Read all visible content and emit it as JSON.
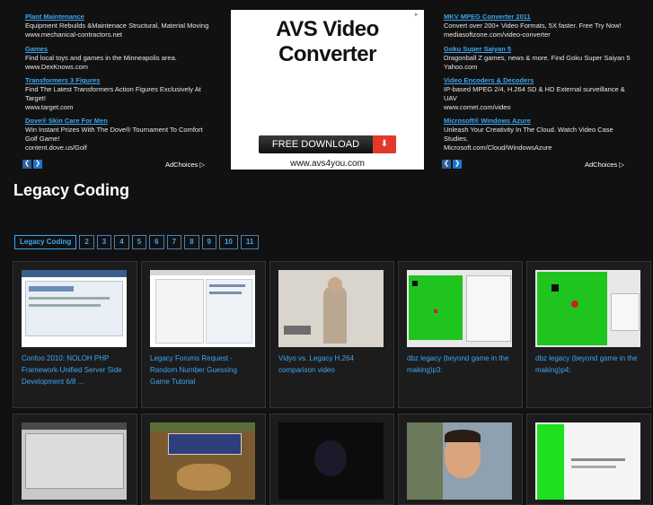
{
  "ads_left": [
    {
      "title": "Plant Maintenance",
      "desc": "Equipment Rebuilds &Maintenace Structural, Material Moving",
      "url": "www.mechanical-contractors.net"
    },
    {
      "title": "Games",
      "desc": "Find local toys and games in the Minneapolis area.",
      "url": "www.DexKnows.com"
    },
    {
      "title": "Transformers 3 Figures",
      "desc": "Find The Latest Transformers Action Figures Exclusively At Target!",
      "url": "www.target.com"
    },
    {
      "title": "Dove® Skin Care For Men",
      "desc": "Win Instant Prizes With The Dove® Tournament To Comfort Golf Game!",
      "url": "content.dove.us/Golf"
    }
  ],
  "ads_right": [
    {
      "title": "MKV MPEG Converter 2011",
      "desc": "Convert over 200+ Video Formats, 5X faster. Free Try Now!",
      "url": "mediasoftzone.com/video-converter"
    },
    {
      "title": "Goku Super Saiyan 5",
      "desc": "Dragonball Z games, news & more. Find Goku Super Saiyan 5",
      "url": "Yahoo.com"
    },
    {
      "title": "Video Encoders & Decoders",
      "desc": "IP-based MPEG 2/4, H.264 SD & HD External surveillance & UAV",
      "url": "www.comet.com/video"
    },
    {
      "title": "Microsoft® Windows Azure",
      "desc": "Unleash Your Creativity In The Cloud. Watch Video Case Studies.",
      "url": "Microsoft.com/Cloud/WindowsAzure"
    }
  ],
  "adchoices": "AdChoices",
  "banner": {
    "title": "AVS Video Converter",
    "button": "FREE DOWNLOAD",
    "url": "www.avs4you.com"
  },
  "page_title": "Legacy Coding",
  "pager": [
    "Legacy Coding",
    "2",
    "3",
    "4",
    "5",
    "6",
    "7",
    "8",
    "9",
    "10",
    "11"
  ],
  "videos_row1": [
    {
      "title": "Confoo 2010: NOLOH PHP Framework-Unified Server Side Development 6/8 ..."
    },
    {
      "title": "Legacy Forums Request - Random Number Guessing Game Tutorial"
    },
    {
      "title": "Vidyo vs. Legacy H.264 comparison video"
    },
    {
      "title": "dbz legacy (beyond game in the making)p3:"
    },
    {
      "title": "dbz legacy (beyond game in the making)p4:"
    }
  ],
  "colors": {
    "link": "#3ea6f2",
    "background": "#111111",
    "card": "#1c1c1c"
  }
}
